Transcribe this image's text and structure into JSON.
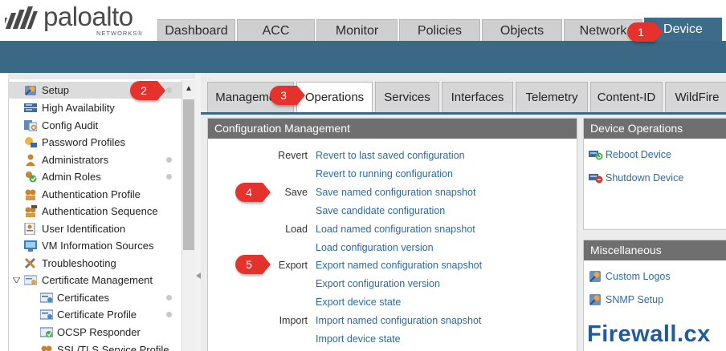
{
  "brand": {
    "name": "paloalto",
    "sub": "NETWORKS®"
  },
  "main_tabs": [
    {
      "label": "Dashboard"
    },
    {
      "label": "ACC"
    },
    {
      "label": "Monitor"
    },
    {
      "label": "Policies"
    },
    {
      "label": "Objects"
    },
    {
      "label": "Network"
    },
    {
      "label": "Device",
      "active": true
    }
  ],
  "sidebar": {
    "items": [
      {
        "label": "Setup",
        "icon": "setup-icon",
        "selected": true,
        "dot": true
      },
      {
        "label": "High Availability",
        "icon": "high-availability-icon"
      },
      {
        "label": "Config Audit",
        "icon": "config-audit-icon"
      },
      {
        "label": "Password Profiles",
        "icon": "password-profile-icon"
      },
      {
        "label": "Administrators",
        "icon": "administrator-icon",
        "dot": true
      },
      {
        "label": "Admin Roles",
        "icon": "admin-roles-icon",
        "dot": true
      },
      {
        "label": "Authentication Profile",
        "icon": "authentication-profile-icon"
      },
      {
        "label": "Authentication Sequence",
        "icon": "authentication-sequence-icon"
      },
      {
        "label": "User Identification",
        "icon": "user-identification-icon"
      },
      {
        "label": "VM Information Sources",
        "icon": "vm-information-icon"
      },
      {
        "label": "Troubleshooting",
        "icon": "troubleshooting-icon"
      },
      {
        "label": "Certificate Management",
        "icon": "certificate-management-icon",
        "expanded": true
      },
      {
        "label": "Certificates",
        "icon": "certificate-icon",
        "child": true,
        "dot": true
      },
      {
        "label": "Certificate Profile",
        "icon": "certificate-profile-icon",
        "child": true,
        "dot": true
      },
      {
        "label": "OCSP Responder",
        "icon": "ocsp-responder-icon",
        "child": true
      },
      {
        "label": "SSL/TLS Service Profile",
        "icon": "ssl-tls-icon",
        "child": true
      }
    ],
    "scroll_up": "▲"
  },
  "sub_tabs": [
    {
      "label": "Management"
    },
    {
      "label": "Operations",
      "active": true
    },
    {
      "label": "Services"
    },
    {
      "label": "Interfaces"
    },
    {
      "label": "Telemetry"
    },
    {
      "label": "Content-ID"
    },
    {
      "label": "WildFire"
    }
  ],
  "config_management": {
    "title": "Configuration Management",
    "rows": [
      {
        "label": "Revert",
        "link": "Revert to last saved configuration"
      },
      {
        "label": "",
        "link": "Revert to running configuration"
      },
      {
        "label": "Save",
        "link": "Save named configuration snapshot"
      },
      {
        "label": "",
        "link": "Save candidate configuration"
      },
      {
        "label": "Load",
        "link": "Load named configuration snapshot"
      },
      {
        "label": "",
        "link": "Load configuration version"
      },
      {
        "label": "Export",
        "link": "Export named configuration snapshot"
      },
      {
        "label": "",
        "link": "Export configuration version"
      },
      {
        "label": "",
        "link": "Export device state"
      },
      {
        "label": "Import",
        "link": "Import named configuration snapshot"
      },
      {
        "label": "",
        "link": "Import device state"
      }
    ]
  },
  "device_operations": {
    "title": "Device Operations",
    "items": [
      {
        "label": "Reboot Device",
        "icon": "reboot-icon"
      },
      {
        "label": "Shutdown Device",
        "icon": "shutdown-icon"
      }
    ]
  },
  "miscellaneous": {
    "title": "Miscellaneous",
    "items": [
      {
        "label": "Custom Logos",
        "icon": "custom-logos-icon"
      },
      {
        "label": "SNMP Setup",
        "icon": "snmp-setup-icon"
      }
    ]
  },
  "callouts": [
    "1",
    "2",
    "3",
    "4",
    "5"
  ],
  "watermark": "Firewall.cx",
  "colors": {
    "accent_blue": "#3b6885",
    "link_blue": "#2c6aa0",
    "callout_red": "#e5322d",
    "panel_header_gray": "#6f6f6f"
  }
}
